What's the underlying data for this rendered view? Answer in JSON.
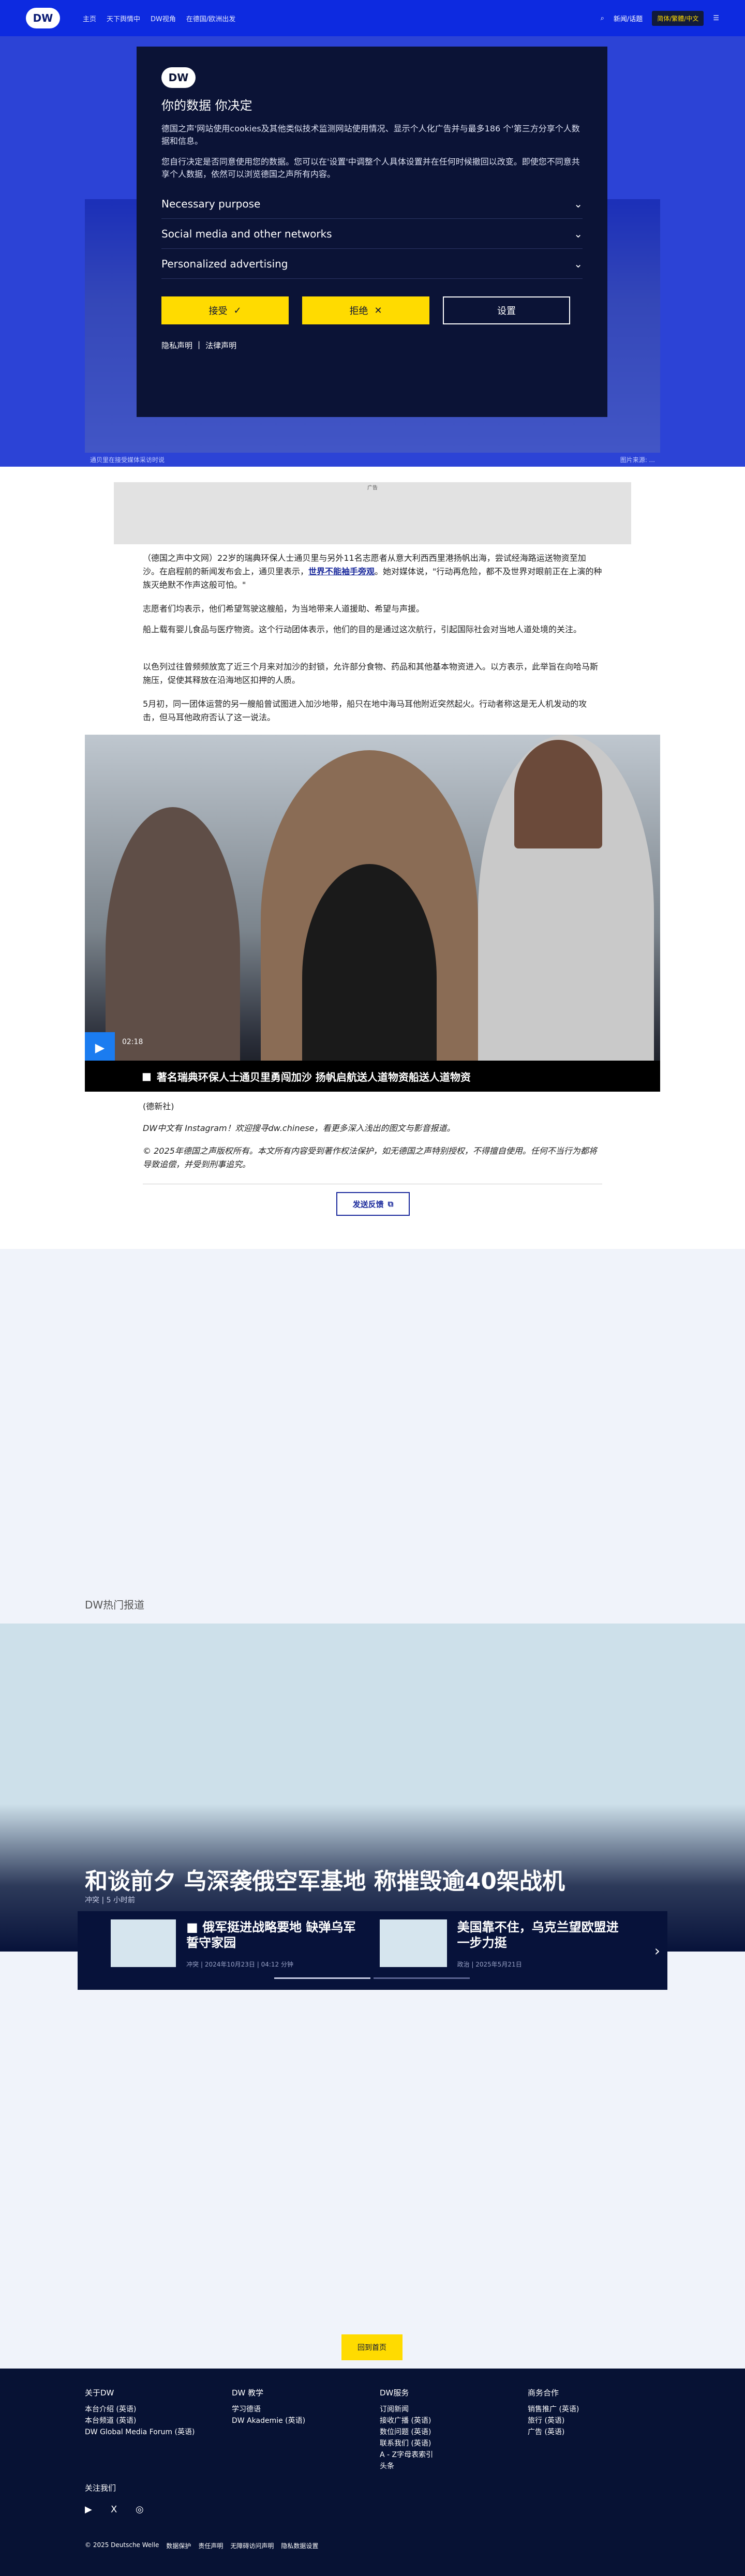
{
  "header": {
    "logo": "DW",
    "nav": [
      "主页",
      "天下舆情中",
      "DW视角",
      "在德国/欧洲出发"
    ],
    "right_links": [
      "新闻/话题"
    ],
    "lang": "简体/繁體/中文"
  },
  "cookie": {
    "logo": "DW",
    "title": "你的数据 你决定",
    "p1": "德国之声'网站使用cookies及其他类似技术监测网站使用情况、显示个人化广告并与最多186 个'第三方分享个人数据和信息。",
    "p2": "您自行决定是否同意使用您的数据。您可以在'设置'中调整个人具体设置并在任何时候撤回以改变。即使您不同意共享个人数据，依然可以浏览德国之声所有内容。",
    "sections": [
      "Necessary purpose",
      "Social media and other networks",
      "Personalized advertising"
    ],
    "accept": "接受",
    "reject": "拒绝",
    "settings": "设置",
    "privacy": "隐私声明",
    "legal": "法律声明"
  },
  "hero": {
    "caption": "通贝里在接受媒体采访时说",
    "credit": "图片来源: ..."
  },
  "article": {
    "ad": "广告",
    "p1": "（德国之声中文网）22岁的瑞典环保人士通贝里与另外11名志愿者从意大利西西里港扬帆出海，尝试经海路运送物资至加沙。在启程前的新闻发布会上，通贝里表示，",
    "p1_link": "世界不能袖手旁观",
    "p1_end": "。她对媒体说，\"行动再危险，都不及世界对眼前正在上演的种族灭绝默不作声这般可怕。\"",
    "p2": "志愿者们均表示，他们希望驾驶这艘船，为当地带来人道援助、希望与声援。",
    "p3": "船上载有婴儿食品与医疗物资。这个行动团体表示，他们的目的是通过这次航行，引起国际社会对当地人道处境的关注。",
    "p4": "以色列过往曾频频放宽了近三个月来对加沙的封锁，允许部分食物、药品和其他基本物资进入。以方表示，此举旨在向哈马斯施压，促使其释放在沿海地区扣押的人质。",
    "p5": "5月初，同一团体运营的另一艘船曾试图进入加沙地带，船只在地中海马耳他附近突然起火。行动者称这是无人机发动的攻击，但马耳他政府否认了这一说法。",
    "video_time": "02:18",
    "video_title": "著名瑞典环保人士通贝里勇闯加沙 扬帆启航送人道物资船送人道物资",
    "source": "(德新社)",
    "instagram": "DW中文有 Instagram！欢迎搜寻dw.chinese，看更多深入浅出的图文与影音报道。",
    "copyright": "© 2025年德国之声版权所有。本文所有内容受到著作权法保护，如无德国之声特别授权，不得擅自使用。任何不当行为都将导致追偿，并受到刑事追究。",
    "feedback": "发送反馈"
  },
  "popular": {
    "label": "DW热门报道",
    "title": "和谈前夕 乌深袭俄空军基地 称摧毁逾40架战机",
    "meta": "冲突 | 5 小时前",
    "cards": [
      {
        "title": "俄军挺进战略要地 缺弹乌军誓守家园",
        "meta": "冲突 | 2024年10月23日 | 04:12 分钟"
      },
      {
        "title": "美国靠不住，乌克兰望欧盟进一步力挺",
        "meta": "政治 | 2025年5月21日"
      }
    ],
    "next": "›"
  },
  "home_button": "回到首页",
  "footer": {
    "cols": [
      {
        "title": "关于DW",
        "items": [
          "本台介绍 (英语)",
          "本台频道 (英语)",
          "DW Global Media Forum (英语)"
        ]
      },
      {
        "title": "DW 教学",
        "items": [
          "学习德语",
          "DW Akademie (英语)"
        ]
      },
      {
        "title": "DW服务",
        "items": [
          "订阅新闻",
          "接收广播 (英语)",
          "数位问题 (英语)",
          "联系我们 (英语)",
          "A - Z字母表索引",
          "头条"
        ]
      },
      {
        "title": "商务合作",
        "items": [
          "销售推广 (英语)",
          "旅行 (英语)",
          "广告 (英语)"
        ]
      }
    ],
    "follow": "关注我们",
    "social": [
      "▶",
      "X",
      "◎"
    ],
    "bottom": [
      "© 2025 Deutsche Welle",
      "数据保护",
      "责任声明",
      "无障碍访问声明",
      "隐私数据设置"
    ]
  }
}
